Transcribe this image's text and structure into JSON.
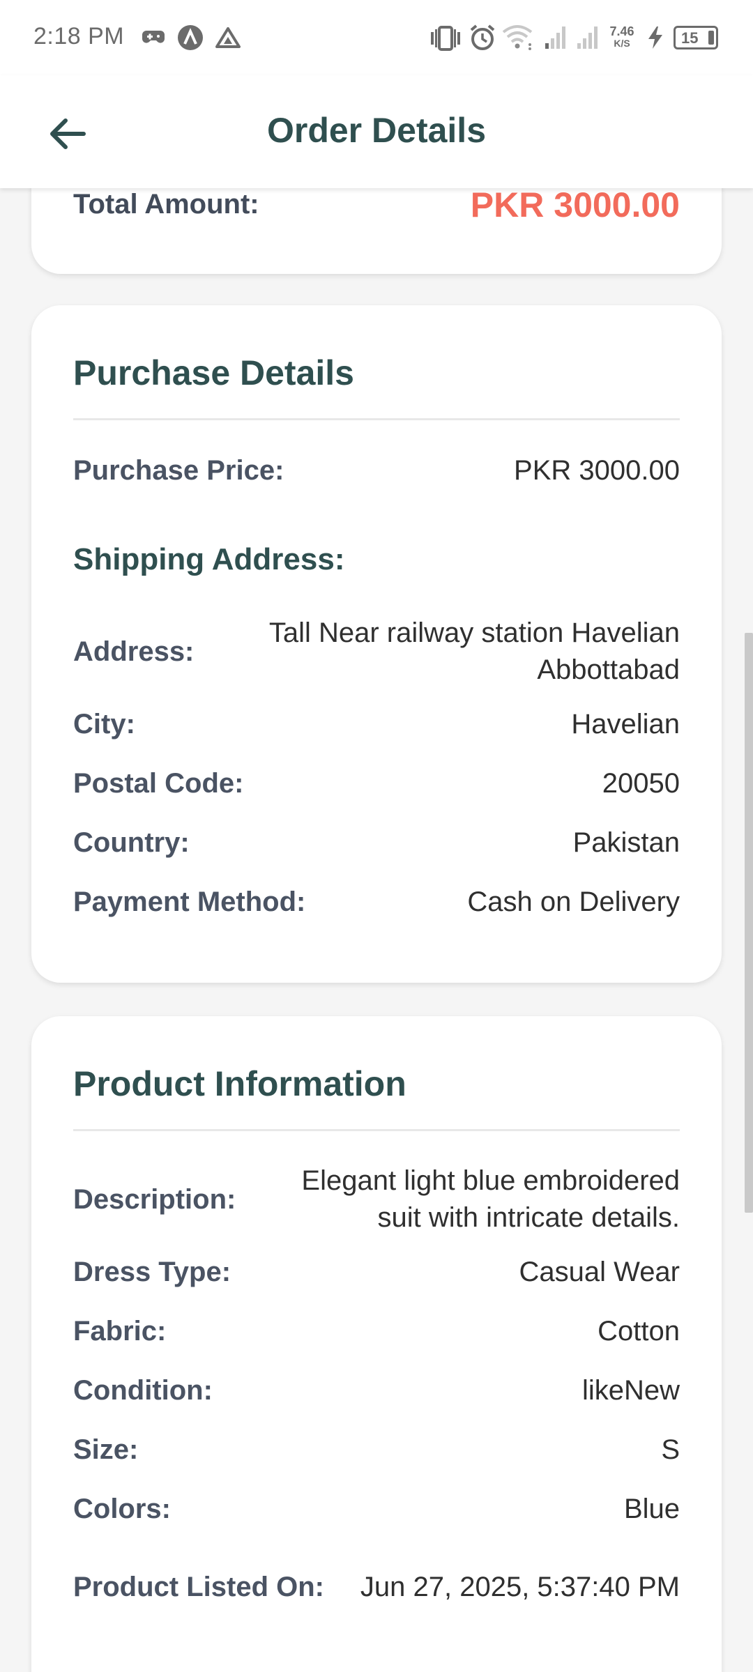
{
  "status_bar": {
    "time": "2:18 PM",
    "network_speed_value": "7.46",
    "network_speed_unit": "K/S",
    "battery": "15",
    "icons": [
      "game-controller-icon",
      "nfc-a-icon",
      "drive-icon",
      "vibrate-icon",
      "alarm-icon",
      "wifi-icon",
      "signal-icon",
      "signal-icon",
      "charging-bolt-icon",
      "battery-icon"
    ]
  },
  "app_bar": {
    "title": "Order Details",
    "back_icon": "arrow-left-icon"
  },
  "summary": {
    "label": "Total Amount:",
    "value": "PKR 3000.00"
  },
  "purchase": {
    "title": "Purchase Details",
    "rows": [
      {
        "label": "Purchase Price:",
        "value": "PKR 3000.00"
      }
    ],
    "shipping_heading": "Shipping Address:",
    "address_rows": [
      {
        "label": "Address:",
        "value": "Tall Near railway station Havelian Abbottabad"
      },
      {
        "label": "City:",
        "value": "Havelian"
      },
      {
        "label": "Postal Code:",
        "value": "20050"
      },
      {
        "label": "Country:",
        "value": "Pakistan"
      },
      {
        "label": "Payment Method:",
        "value": "Cash on Delivery"
      }
    ]
  },
  "product": {
    "title": "Product Information",
    "rows": [
      {
        "label": "Description:",
        "value": "Elegant light blue embroidered suit with intricate details."
      },
      {
        "label": "Dress Type:",
        "value": "Casual Wear"
      },
      {
        "label": "Fabric:",
        "value": "Cotton"
      },
      {
        "label": "Condition:",
        "value": "likeNew"
      },
      {
        "label": "Size:",
        "value": "S"
      },
      {
        "label": "Colors:",
        "value": "Blue"
      },
      {
        "label": "Product Listed On:",
        "value": "Jun 27, 2025, 5:37:40 PM"
      }
    ]
  },
  "colors": {
    "heading": "#2f4f4f",
    "accent_price": "#f26b5b",
    "label": "#4a5363",
    "value": "#2f2f2f",
    "background": "#f5f5f5"
  }
}
